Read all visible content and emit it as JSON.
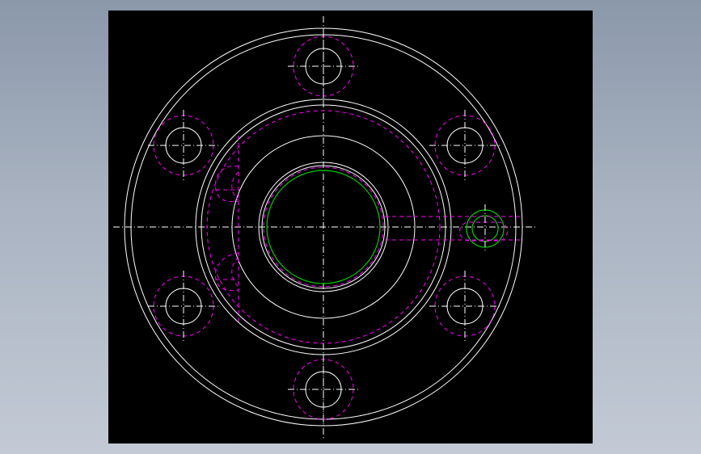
{
  "app": {
    "background_gradient": [
      "#8b98aa",
      "#c3cad6"
    ]
  },
  "drawing": {
    "canvas_color": "#000000",
    "colors": {
      "outline": "#ffffff",
      "hidden": "#ff00ff",
      "bore": "#00cc00",
      "centerline": "#ffffff"
    },
    "view": "front",
    "features": {
      "flange_outer": "circle",
      "bolt_holes": 6,
      "center_bore": "circle",
      "side_port": "circle",
      "hidden_pocket": "dashed"
    }
  }
}
